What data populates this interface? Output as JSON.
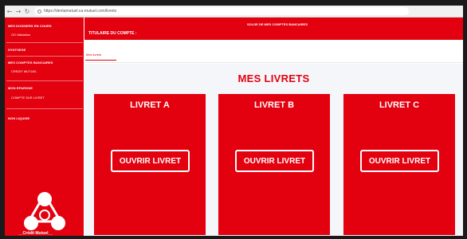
{
  "browser": {
    "url": "https://dentamutuel.ca-mutuel.com/livrets",
    "back_glyph": "←",
    "forward_glyph": "→",
    "reload_glyph": "↻"
  },
  "sidebar": {
    "items": [
      {
        "label": "MES DOSSIERS EN COURS",
        "sub": "OS Validation"
      },
      {
        "label": "SYNTHESE"
      },
      {
        "label": "MES COMPTES BANCAIRES",
        "sub": "CREDIT MUTUEL"
      },
      {
        "label": "MON EPARGNE",
        "sub": "COMPTE SUR LIVRET"
      },
      {
        "label": "NON LIQUIDE"
      }
    ],
    "logo_text": "__Crédit Mutuel__"
  },
  "topbar": {
    "solde_label": "SOLDE DE MES COMPTES BANCAIRES",
    "titulaire_label": "TITULAIRE DU COMPTE :"
  },
  "tabs": [
    {
      "label": "Mes livrets"
    }
  ],
  "main": {
    "heading": "MES LIVRETS",
    "cards": [
      {
        "title": "LIVRET A",
        "button": "OUVRIR LIVRET"
      },
      {
        "title": "LIVRET B",
        "button": "OUVRIR LIVRET"
      },
      {
        "title": "LIVRET C",
        "button": "OUVRIR LIVRET"
      }
    ]
  },
  "colors": {
    "brand_red": "#e3000f",
    "content_bg": "#f5f6fa",
    "white": "#ffffff"
  },
  "icons": [
    "back-icon",
    "forward-icon",
    "reload-icon",
    "lock-icon",
    "credit-mutuel-logo"
  ]
}
